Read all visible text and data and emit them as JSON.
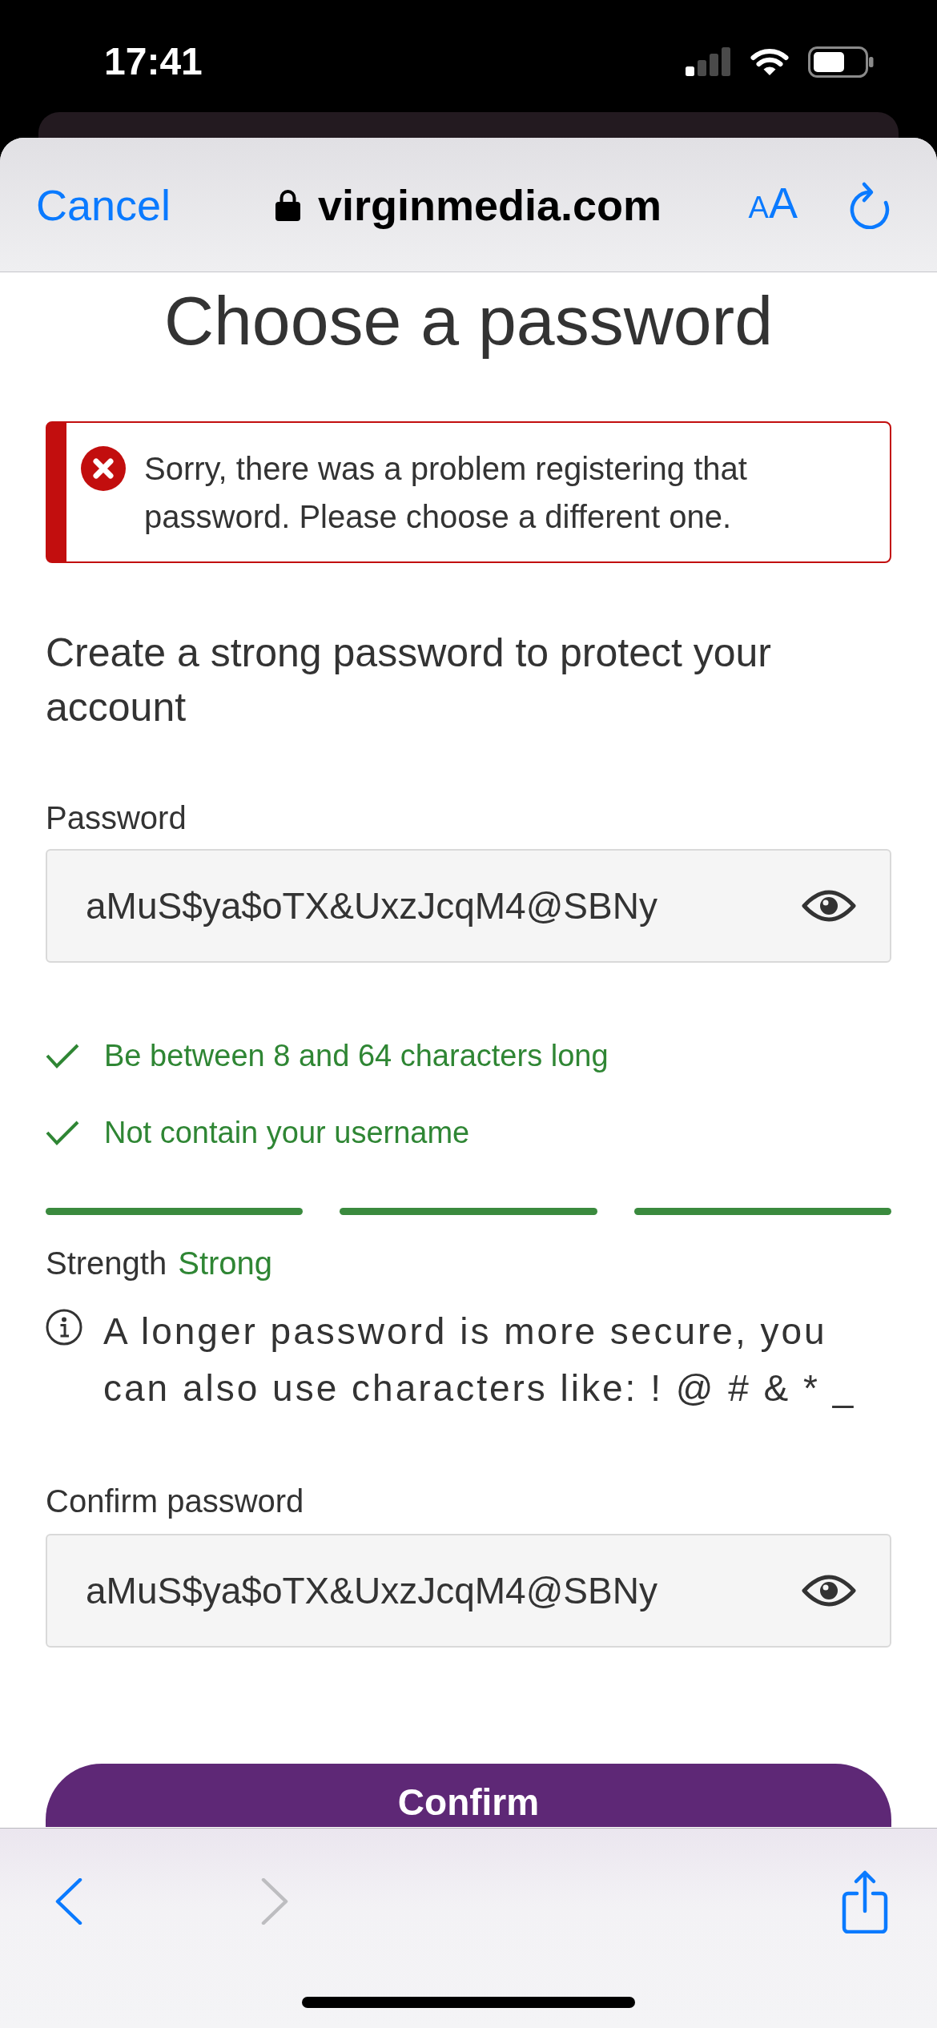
{
  "status_bar": {
    "time": "17:41"
  },
  "browser_header": {
    "cancel": "Cancel",
    "domain": "virginmedia.com",
    "text_size": "AA"
  },
  "page": {
    "title": "Choose a password",
    "error": {
      "message": "Sorry, there was a problem registering that password. Please choose a different one."
    },
    "heading": "Create a strong password to protect your account",
    "password": {
      "label": "Password",
      "value": "aMuS$ya$oTX&UxzJcqM4@SBNy"
    },
    "rules": [
      {
        "text": "Be between 8 and 64 characters long",
        "met": true
      },
      {
        "text": "Not contain your username",
        "met": true
      }
    ],
    "strength": {
      "segments": [
        {
          "filled": true
        },
        {
          "filled": true
        },
        {
          "filled": true
        }
      ],
      "label": "Strength",
      "value": "Strong"
    },
    "tip": "A longer password is more secure, you can also use characters like: ! @ # & * _",
    "confirm_password": {
      "label": "Confirm password",
      "value": "aMuS$ya$oTX&UxzJcqM4@SBNy"
    },
    "confirm_button": "Confirm"
  },
  "toolbar": {
    "back": {
      "disabled": false
    },
    "forward": {
      "disabled": true
    }
  }
}
